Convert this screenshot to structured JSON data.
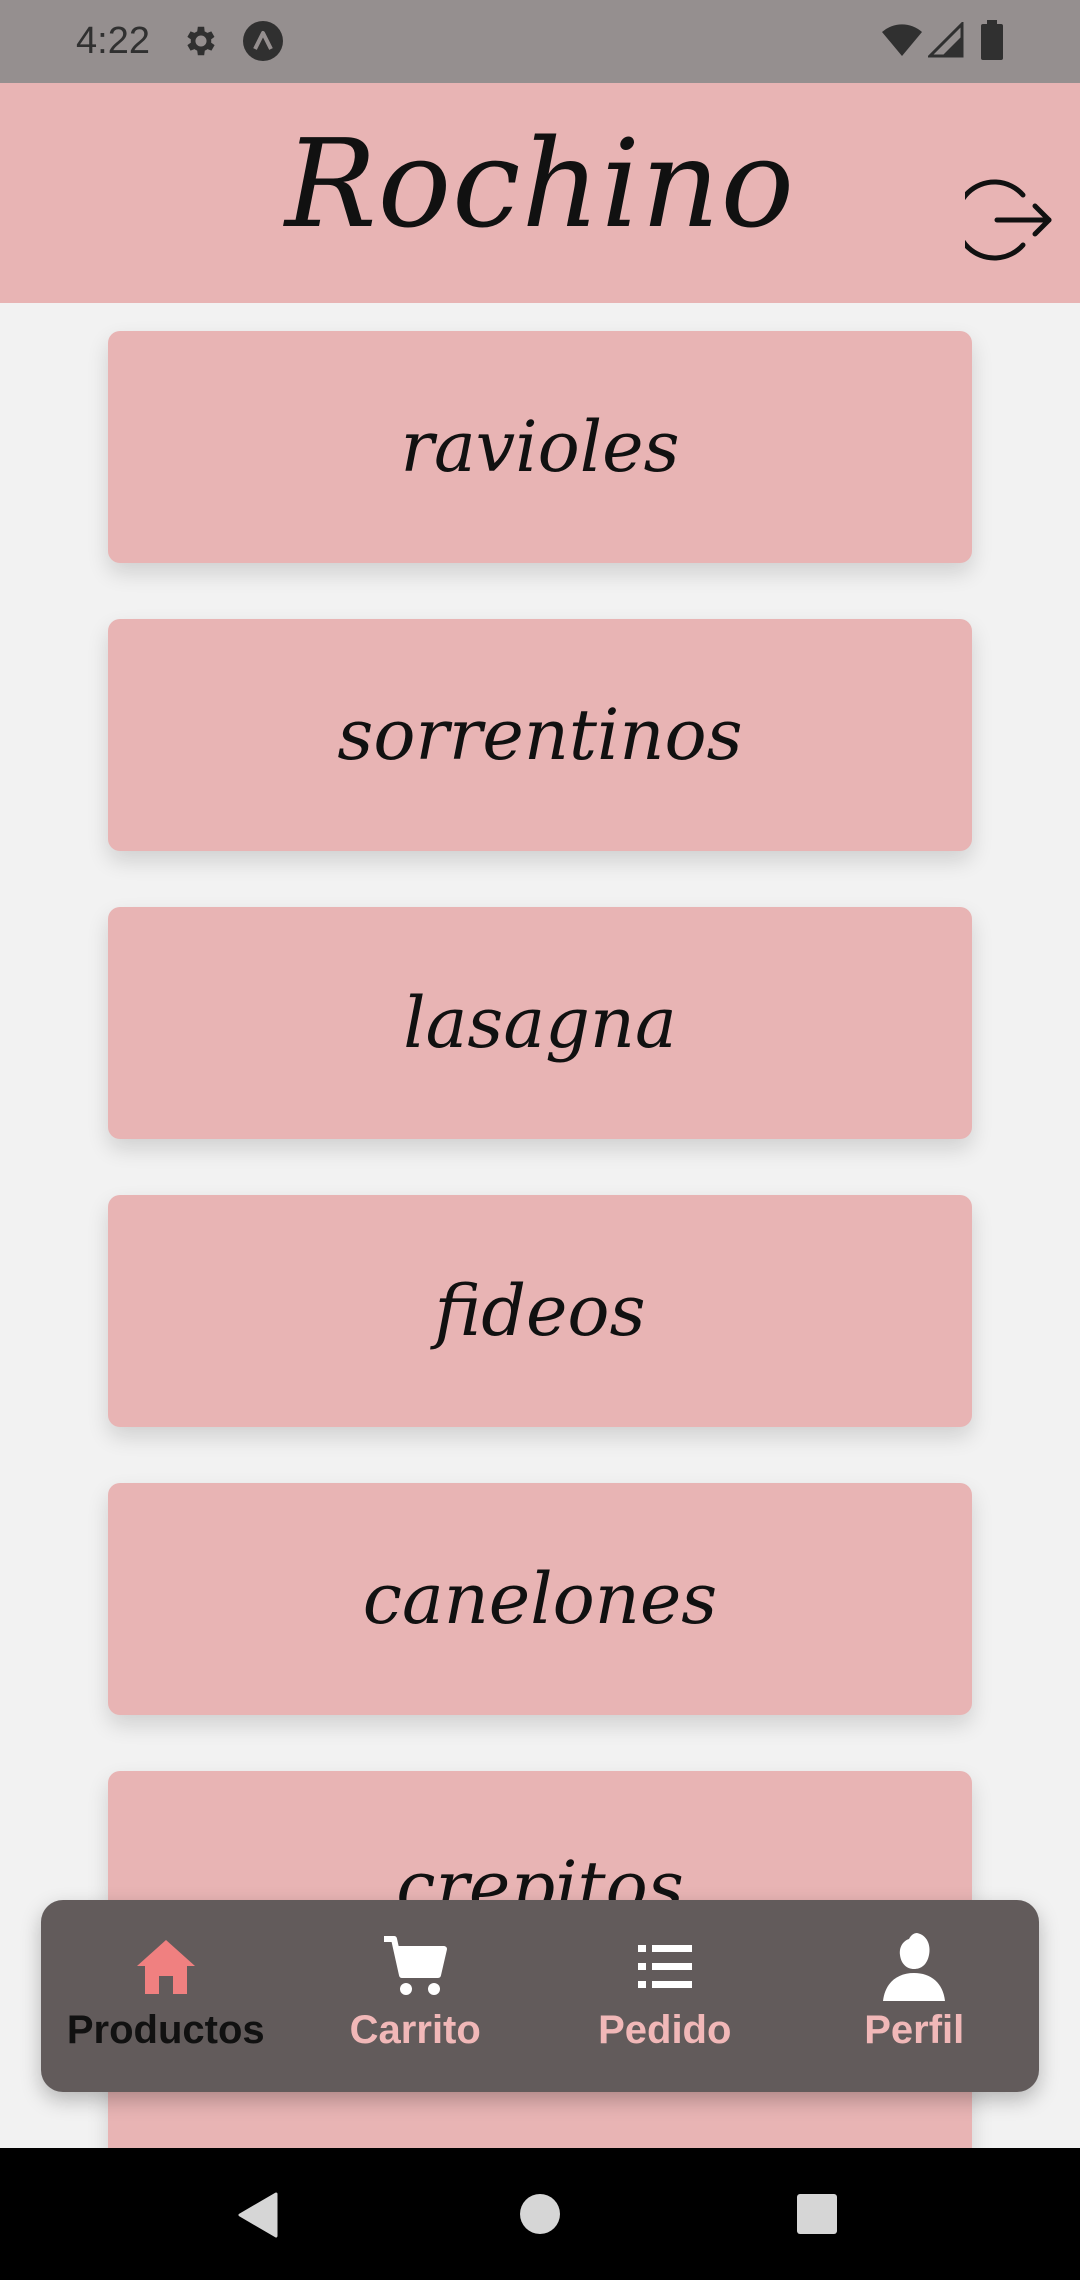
{
  "status_bar": {
    "time": "4:22",
    "icons": [
      "gear-icon",
      "app-a-icon",
      "wifi-icon",
      "signal-icon",
      "battery-icon"
    ]
  },
  "header": {
    "title": "Rochino",
    "logout_icon": "logout-icon"
  },
  "products": [
    {
      "label": "ravioles"
    },
    {
      "label": "sorrentinos"
    },
    {
      "label": "lasagna"
    },
    {
      "label": "fideos"
    },
    {
      "label": "canelones"
    },
    {
      "label": "crepitos"
    }
  ],
  "bottom_nav": {
    "items": [
      {
        "label": "Productos",
        "icon": "home-icon",
        "active": true
      },
      {
        "label": "Carrito",
        "icon": "cart-icon",
        "active": false
      },
      {
        "label": "Pedido",
        "icon": "list-icon",
        "active": false
      },
      {
        "label": "Perfil",
        "icon": "user-icon",
        "active": false
      }
    ]
  },
  "colors": {
    "brand_pink": "#e8b4b4",
    "nav_bg": "#625b5b",
    "nav_label": "#f1b8b8",
    "active_icon": "#f08080"
  }
}
